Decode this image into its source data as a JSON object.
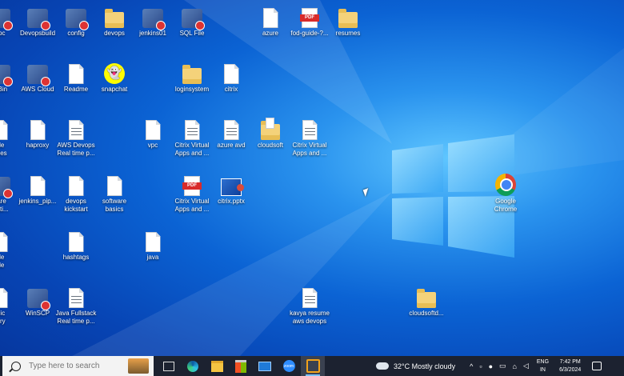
{
  "desktop_icons": [
    {
      "label": "ppc",
      "type": "app"
    },
    {
      "label": "Devopsbuild",
      "type": "app"
    },
    {
      "label": "config",
      "type": "app"
    },
    {
      "label": "devops",
      "type": "folder"
    },
    {
      "label": "jenkins01",
      "type": "app"
    },
    {
      "label": "SQL File",
      "type": "app"
    },
    {
      "label": "azure",
      "type": "doc"
    },
    {
      "label": "fod-guide-?...",
      "type": "pdf"
    },
    {
      "label": "resumes",
      "type": "folder"
    },
    {
      "label": "e Bin",
      "type": "app"
    },
    {
      "label": "AWS Cloud",
      "type": "app"
    },
    {
      "label": "Readme",
      "type": "doc"
    },
    {
      "label": "snapchat",
      "type": "snapchat"
    },
    {
      "label": "loginsystem",
      "type": "folder"
    },
    {
      "label": "citrix",
      "type": "doc"
    },
    {
      "label": "dle\nreles",
      "type": "doc"
    },
    {
      "label": "haproxy",
      "type": "doc"
    },
    {
      "label": "AWS Devops\nReal time p...",
      "type": "doclines"
    },
    {
      "label": "vpc",
      "type": "doc"
    },
    {
      "label": "Citrix Virtual\nApps and ...",
      "type": "doclines"
    },
    {
      "label": "azure avd",
      "type": "doclines"
    },
    {
      "label": "cloudsoft",
      "type": "archive"
    },
    {
      "label": "Citrix Virtual\nApps and ...",
      "type": "doclines"
    },
    {
      "label": "vare\nstati...",
      "type": "app"
    },
    {
      "label": "jenkins_pip...",
      "type": "doc"
    },
    {
      "label": "devops\nkickstart",
      "type": "doc"
    },
    {
      "label": "software\nbasics",
      "type": "doc"
    },
    {
      "label": "Citrix Virtual\nApps and ...",
      "type": "pdf"
    },
    {
      "label": "citrix.pptx",
      "type": "ppt"
    },
    {
      "label": "Google\nChrome",
      "type": "chrome"
    },
    {
      "label": "ble\nble",
      "type": "doc"
    },
    {
      "label": "hashtags",
      "type": "doc"
    },
    {
      "label": "java",
      "type": "doc"
    },
    {
      "label": "mic\ntory",
      "type": "doc"
    },
    {
      "label": "WinSCP",
      "type": "app"
    },
    {
      "label": "Java Fullstack\nReal time p...",
      "type": "doclines"
    },
    {
      "label": "kavya resume\naws devops",
      "type": "doclines"
    },
    {
      "label": "cloudsoftd...",
      "type": "folder"
    }
  ],
  "taskbar": {
    "search_placeholder": "Type here to search",
    "apps": [
      "task-view",
      "edge",
      "file-explorer",
      "microsoft-store",
      "mail",
      "zoom",
      "virtualbox"
    ],
    "weather": "32°C  Mostly cloudy",
    "lang_line1": "ENG",
    "lang_line2": "IN",
    "time": "7:42 PM",
    "date": "6/3/2024"
  },
  "colors": {
    "taskbar_bg": "#1c2230",
    "desktop_accent": "#0b63d4"
  }
}
